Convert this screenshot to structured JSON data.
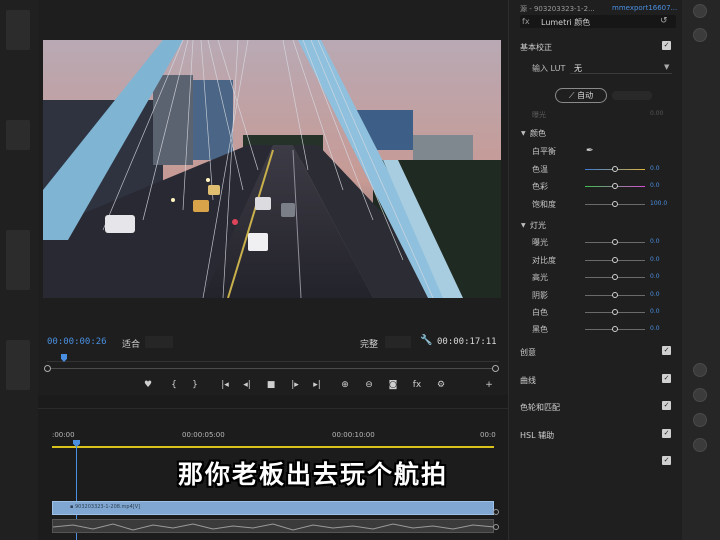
{
  "monitor": {
    "timecode_current": "00:00:00:26",
    "fit_label": "适合",
    "quality_label": "完整",
    "timecode_duration": "00:00:17:11",
    "controls": [
      "♥",
      "{",
      "}",
      "|◂",
      "◂|",
      "■",
      "|▸",
      "▸|",
      "⊕",
      "⊖",
      "◙",
      "fx",
      "⚙",
      "+"
    ]
  },
  "timeline": {
    "ruler": [
      ":00:00",
      "00:00:05:00",
      "00:00:10:00",
      "00:0"
    ],
    "video_clip_label": "▪ 903203323-1-208.mp4[V]"
  },
  "subtitle": "那你老板出去玩个航拍",
  "lumetri": {
    "tab_source": "源 - 903203323-1-2...",
    "tab_active": "mmexport16607...",
    "fx_label": "fx",
    "preset": "Lumetri 颜色",
    "basic_correction": {
      "title": "基本校正",
      "lut_label": "输入 LUT",
      "lut_value": "无",
      "auto_button": "自动",
      "exposure_label": "曝光",
      "exposure_value": "0.00"
    },
    "color": {
      "title": "颜色",
      "white_balance_label": "白平衡",
      "temperature_label": "色温",
      "temperature_value": "0.0",
      "tint_label": "色彩",
      "tint_value": "0.0",
      "saturation_label": "饱和度",
      "saturation_value": "100.0"
    },
    "light": {
      "title": "灯光",
      "exposure_label": "曝光",
      "exposure_value": "0.0",
      "contrast_label": "对比度",
      "contrast_value": "0.0",
      "highlights_label": "高光",
      "highlights_value": "0.0",
      "shadows_label": "阴影",
      "shadows_value": "0.0",
      "whites_label": "白色",
      "whites_value": "0.0",
      "blacks_label": "黑色",
      "blacks_value": "0.0"
    },
    "sections": {
      "creative": "创意",
      "curves": "曲线",
      "color_wheels": "色轮和匹配",
      "hsl": "HSL 辅助"
    }
  },
  "colors": {
    "accent_blue": "#4a8fe0",
    "timeline_yellow": "#d9c21b",
    "clip_blue": "#7fa7d1"
  }
}
